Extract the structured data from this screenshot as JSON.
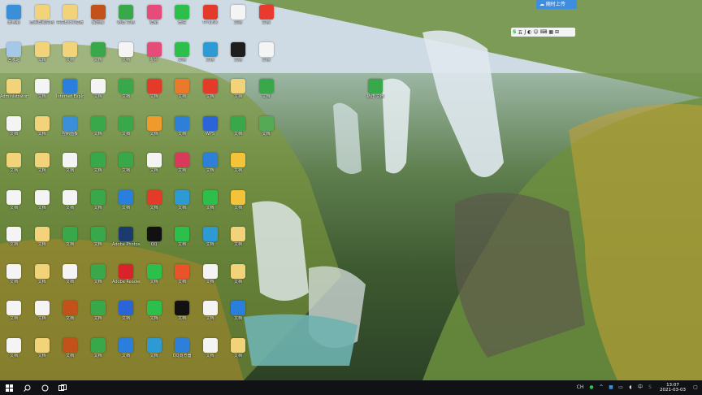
{
  "desktop": {
    "icons": [
      {
        "label": "此电脑",
        "color": "#3b8fd8"
      },
      {
        "label": "查看帮助文档",
        "color": "#f3d37a"
      },
      {
        "label": "中文Excel模板",
        "color": "#f3d37a"
      },
      {
        "label": "解压缩",
        "color": "#c2521a"
      },
      {
        "label": "新建 文档",
        "color": "#39a84b"
      },
      {
        "label": "壁纸",
        "color": "#e54c7a"
      },
      {
        "label": "微信",
        "color": "#2dbf4b"
      },
      {
        "label": "TP-LINK",
        "color": "#e43a2a"
      },
      {
        "label": "文档",
        "color": "#f4f4f4"
      },
      {
        "label": "文档",
        "color": "#e83a2e"
      },
      {
        "label": "回收站",
        "color": "#a6c8e8"
      },
      {
        "label": "文档",
        "color": "#f3d37a"
      },
      {
        "label": "文档",
        "color": "#f3d37a"
      },
      {
        "label": "文档",
        "color": "#39a84b"
      },
      {
        "label": "文档",
        "color": "#f4f4f4"
      },
      {
        "label": "图片",
        "color": "#e54c7a"
      },
      {
        "label": "文档",
        "color": "#2dbf4b"
      },
      {
        "label": "文档",
        "color": "#2d9ad4"
      },
      {
        "label": "文档",
        "color": "#1e1e1e"
      },
      {
        "label": "文档",
        "color": "#f4f4f4"
      },
      {
        "label": "Administrator",
        "color": "#f3d37a"
      },
      {
        "label": "文档",
        "color": "#f4f4f4"
      },
      {
        "label": "Internet Explorer",
        "color": "#2b7fdc"
      },
      {
        "label": "文档",
        "color": "#f4f4f4"
      },
      {
        "label": "文档",
        "color": "#39a84b"
      },
      {
        "label": "文档",
        "color": "#e33a2a"
      },
      {
        "label": "文档",
        "color": "#e97a2b"
      },
      {
        "label": "文档",
        "color": "#e43a2a"
      },
      {
        "label": "文档",
        "color": "#f3d37a"
      },
      {
        "label": "文档",
        "color": "#39a84b"
      },
      {
        "label": "文档",
        "color": "#f4f4f4"
      },
      {
        "label": "文档",
        "color": "#f3d37a"
      },
      {
        "label": "控制面板",
        "color": "#3b8fd8"
      },
      {
        "label": "文档",
        "color": "#39a84b"
      },
      {
        "label": "文档",
        "color": "#39a84b"
      },
      {
        "label": "文档",
        "color": "#f09a2b"
      },
      {
        "label": "文档",
        "color": "#2d7fd8"
      },
      {
        "label": "WPS",
        "color": "#2b64d8"
      },
      {
        "label": "文档",
        "color": "#39a84b"
      },
      {
        "label": "文档",
        "color": "#55aa55"
      },
      {
        "label": "文档",
        "color": "#f3d37a"
      },
      {
        "label": "文档",
        "color": "#f3d37a"
      },
      {
        "label": "文档",
        "color": "#f4f4f4"
      },
      {
        "label": "文档",
        "color": "#39a84b"
      },
      {
        "label": "文档",
        "color": "#39a84b"
      },
      {
        "label": "文档",
        "color": "#f4f4f4"
      },
      {
        "label": "文档",
        "color": "#d83a5a"
      },
      {
        "label": "文档",
        "color": "#2d7fd8"
      },
      {
        "label": "文档",
        "color": "#f3c33a"
      },
      {
        "label": "",
        "color": "transparent"
      },
      {
        "label": "文档",
        "color": "#f4f4f4"
      },
      {
        "label": "文档",
        "color": "#f4f4f4"
      },
      {
        "label": "文档",
        "color": "#f4f4f4"
      },
      {
        "label": "文档",
        "color": "#39a84b"
      },
      {
        "label": "文档",
        "color": "#2b7fdc"
      },
      {
        "label": "文档",
        "color": "#e33a2a"
      },
      {
        "label": "文档",
        "color": "#2d9ad4"
      },
      {
        "label": "文档",
        "color": "#2dbf4b"
      },
      {
        "label": "文档",
        "color": "#f3c33a"
      },
      {
        "label": "",
        "color": "transparent"
      },
      {
        "label": "文档",
        "color": "#f4f4f4"
      },
      {
        "label": "文档",
        "color": "#f3d37a"
      },
      {
        "label": "文档",
        "color": "#39a84b"
      },
      {
        "label": "文档",
        "color": "#39a84b"
      },
      {
        "label": "Adobe Photoshop",
        "color": "#1c3a6e"
      },
      {
        "label": "QQ",
        "color": "#111111"
      },
      {
        "label": "文档",
        "color": "#2dbf4b"
      },
      {
        "label": "文档",
        "color": "#2d9ad4"
      },
      {
        "label": "文档",
        "color": "#f3d37a"
      },
      {
        "label": "",
        "color": "transparent"
      },
      {
        "label": "文档",
        "color": "#f4f4f4"
      },
      {
        "label": "文档",
        "color": "#f3d37a"
      },
      {
        "label": "文档",
        "color": "#f4f4f4"
      },
      {
        "label": "文档",
        "color": "#39a84b"
      },
      {
        "label": "Adobe Reader",
        "color": "#d8232a"
      },
      {
        "label": "文档",
        "color": "#2dbf4b"
      },
      {
        "label": "文档",
        "color": "#e9532a"
      },
      {
        "label": "文档",
        "color": "#f4f4f4"
      },
      {
        "label": "文档",
        "color": "#f3d37a"
      },
      {
        "label": "",
        "color": "transparent"
      },
      {
        "label": "文档",
        "color": "#f4f4f4"
      },
      {
        "label": "文档",
        "color": "#f4f4f4"
      },
      {
        "label": "文档",
        "color": "#c2521a"
      },
      {
        "label": "文档",
        "color": "#39a84b"
      },
      {
        "label": "文档",
        "color": "#2b64d8"
      },
      {
        "label": "文档",
        "color": "#2dbf4b"
      },
      {
        "label": "文档",
        "color": "#111111"
      },
      {
        "label": "文档",
        "color": "#f4f4f4"
      },
      {
        "label": "文档",
        "color": "#2b7fdc"
      },
      {
        "label": "",
        "color": "transparent"
      },
      {
        "label": "文档",
        "color": "#f4f4f4"
      },
      {
        "label": "文档",
        "color": "#f3d37a"
      },
      {
        "label": "文档",
        "color": "#c2521a"
      },
      {
        "label": "文档",
        "color": "#39a84b"
      },
      {
        "label": "文档",
        "color": "#2b7fdc"
      },
      {
        "label": "文档",
        "color": "#2d9ad4"
      },
      {
        "label": "QQ浏览器",
        "color": "#2d7fd8"
      },
      {
        "label": "文档",
        "color": "#f4f4f4"
      },
      {
        "label": "文档",
        "color": "#f3d37a"
      },
      {
        "label": "",
        "color": "transparent"
      }
    ],
    "floating_icon": {
      "label": "新建 文档"
    }
  },
  "cloud_button": {
    "label": "随时上传"
  },
  "toolbar": {
    "items": [
      "五",
      "J",
      "◐",
      "☺",
      "⌨",
      "▦",
      "⊞"
    ]
  },
  "taskbar": {
    "start_icon": "windows-logo-icon",
    "search_icon": "search-icon",
    "cortana_icon": "cortana-icon",
    "taskview_icon": "task-view-icon",
    "tray_language": "CH",
    "clock_time": "13:07",
    "clock_date": "2021-03-03"
  },
  "colors": {
    "taskbar": "#101216",
    "accent": "#3d8de0"
  }
}
